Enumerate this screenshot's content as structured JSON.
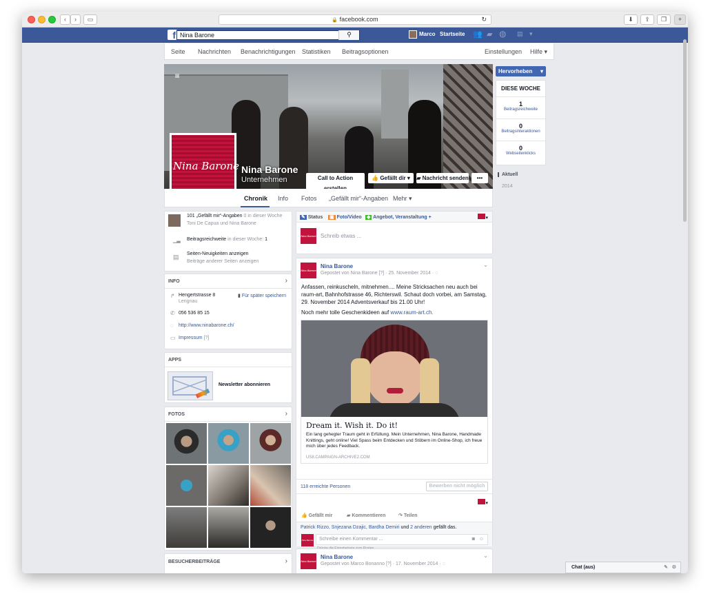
{
  "browser": {
    "url": "facebook.com",
    "lock": "🔒",
    "reload": "↻"
  },
  "topbar": {
    "search_value": "Nina Barone",
    "user_name": "Marco",
    "home_label": "Startseite",
    "logo": "f"
  },
  "pagenav": {
    "items": [
      "Seite",
      "Nachrichten",
      "Benachrichtigungen",
      "Statistiken",
      "Beitragsoptionen"
    ],
    "settings": "Einstellungen",
    "help": "Hilfe ▾"
  },
  "profile": {
    "name": "Nina Barone",
    "category": "Unternehmen",
    "logo_text": "Nina Barone",
    "cta": "Call to Action erstellen",
    "liked": "Gefällt dir ▾",
    "message": "Nachricht senden",
    "more": "•••"
  },
  "tabs": [
    "Chronik",
    "Info",
    "Fotos",
    "„Gefällt mir“-Angaben",
    "Mehr ▾"
  ],
  "promote": {
    "button": "Hervorheben",
    "this_week": "DIESE WOCHE",
    "stats": [
      {
        "value": "1",
        "label": "Beitragsreichweite"
      },
      {
        "value": "0",
        "label": "Beitragsinteraktionen"
      },
      {
        "value": "0",
        "label": "Webseitenklicks"
      }
    ]
  },
  "timeline": {
    "current": "Aktuell",
    "year": "2014"
  },
  "left": {
    "likes_text": "101 „Gefällt mir“-Angaben",
    "likes_gray": "0 in dieser Woche",
    "likes_sub": "Toni De Capua und Nina Barone",
    "reach_text": "Beitragsreichweite",
    "reach_gray": "in dieser Woche:",
    "reach_value": "1",
    "news1": "Seiten-Neuigkeiten anzeigen",
    "news2": "Beiträge anderer Seiten anzeigen",
    "info_h": "INFO",
    "address": "Hengertstrasse 8",
    "city": "Lengnau",
    "save": "Für später speichern",
    "phone": "056 536 85 15",
    "web": "http://www.ninabarone.ch/",
    "impressum": "Impressum",
    "impressum_q": "[?]",
    "apps_h": "APPS",
    "newsletter": "Newsletter abonnieren",
    "photos_h": "FOTOS",
    "visitors_h": "BESUCHERBEITRÄGE"
  },
  "composer": {
    "status": "Status",
    "photo": "Foto/Video",
    "offer": "Angebot, Veranstaltung +",
    "placeholder": "Schreib etwas ..."
  },
  "post1": {
    "author": "Nina Barone",
    "meta": "Gepostet von Nina Barone [?] · 25. November 2014 ·",
    "text": "Anfassen, reinkuscheln, mitnehmen.... Meine Stricksachen neu auch bei raum-art, Bahnhofstrasse 46, Richterswil. Schaut doch vorbei, am Samstag, 29. November 2014 Adventsverkauf bis 21.00 Uhr!",
    "more_text": "Noch mehr tolle Geschenkideen auf",
    "more_link": "www.raum-art.ch.",
    "link_title": "Dream it. Wish it. Do it!",
    "link_desc": "Ein lang gehegter Traum geht in Erfüllung. Mein Unternehmen, Nina Barone, Handmade Knittings, geht online! Viel Spass beim Entdecken und Stöbern im Online-Shop, ich freue mich über jedes Feedback.",
    "link_domain": "US8.CAMPAIGN-ARCHIVE2.COM",
    "reached": "118 erreichte Personen",
    "boost": "Bewerben nicht möglich",
    "like": "Gefällt mir",
    "comment": "Kommentieren",
    "share": "Teilen",
    "likers": "Patrick Rizzo, Snjezana Dzajic, Bardha Demiri",
    "and": "und",
    "others": "2 anderen",
    "liked_this": "gefällt das.",
    "comment_ph": "Schreibe einen Kommentar ...",
    "enter_hint": "Drücke die Eingabetaste zum Posten."
  },
  "post2": {
    "author": "Nina Barone",
    "meta": "Gepostet von Marco Bonanno [?] · 17. November 2014 ·"
  },
  "chat": {
    "label": "Chat (aus)"
  },
  "colors": {
    "fb_blue": "#3b5998",
    "link": "#365899",
    "brand_red": "#c0143c"
  }
}
